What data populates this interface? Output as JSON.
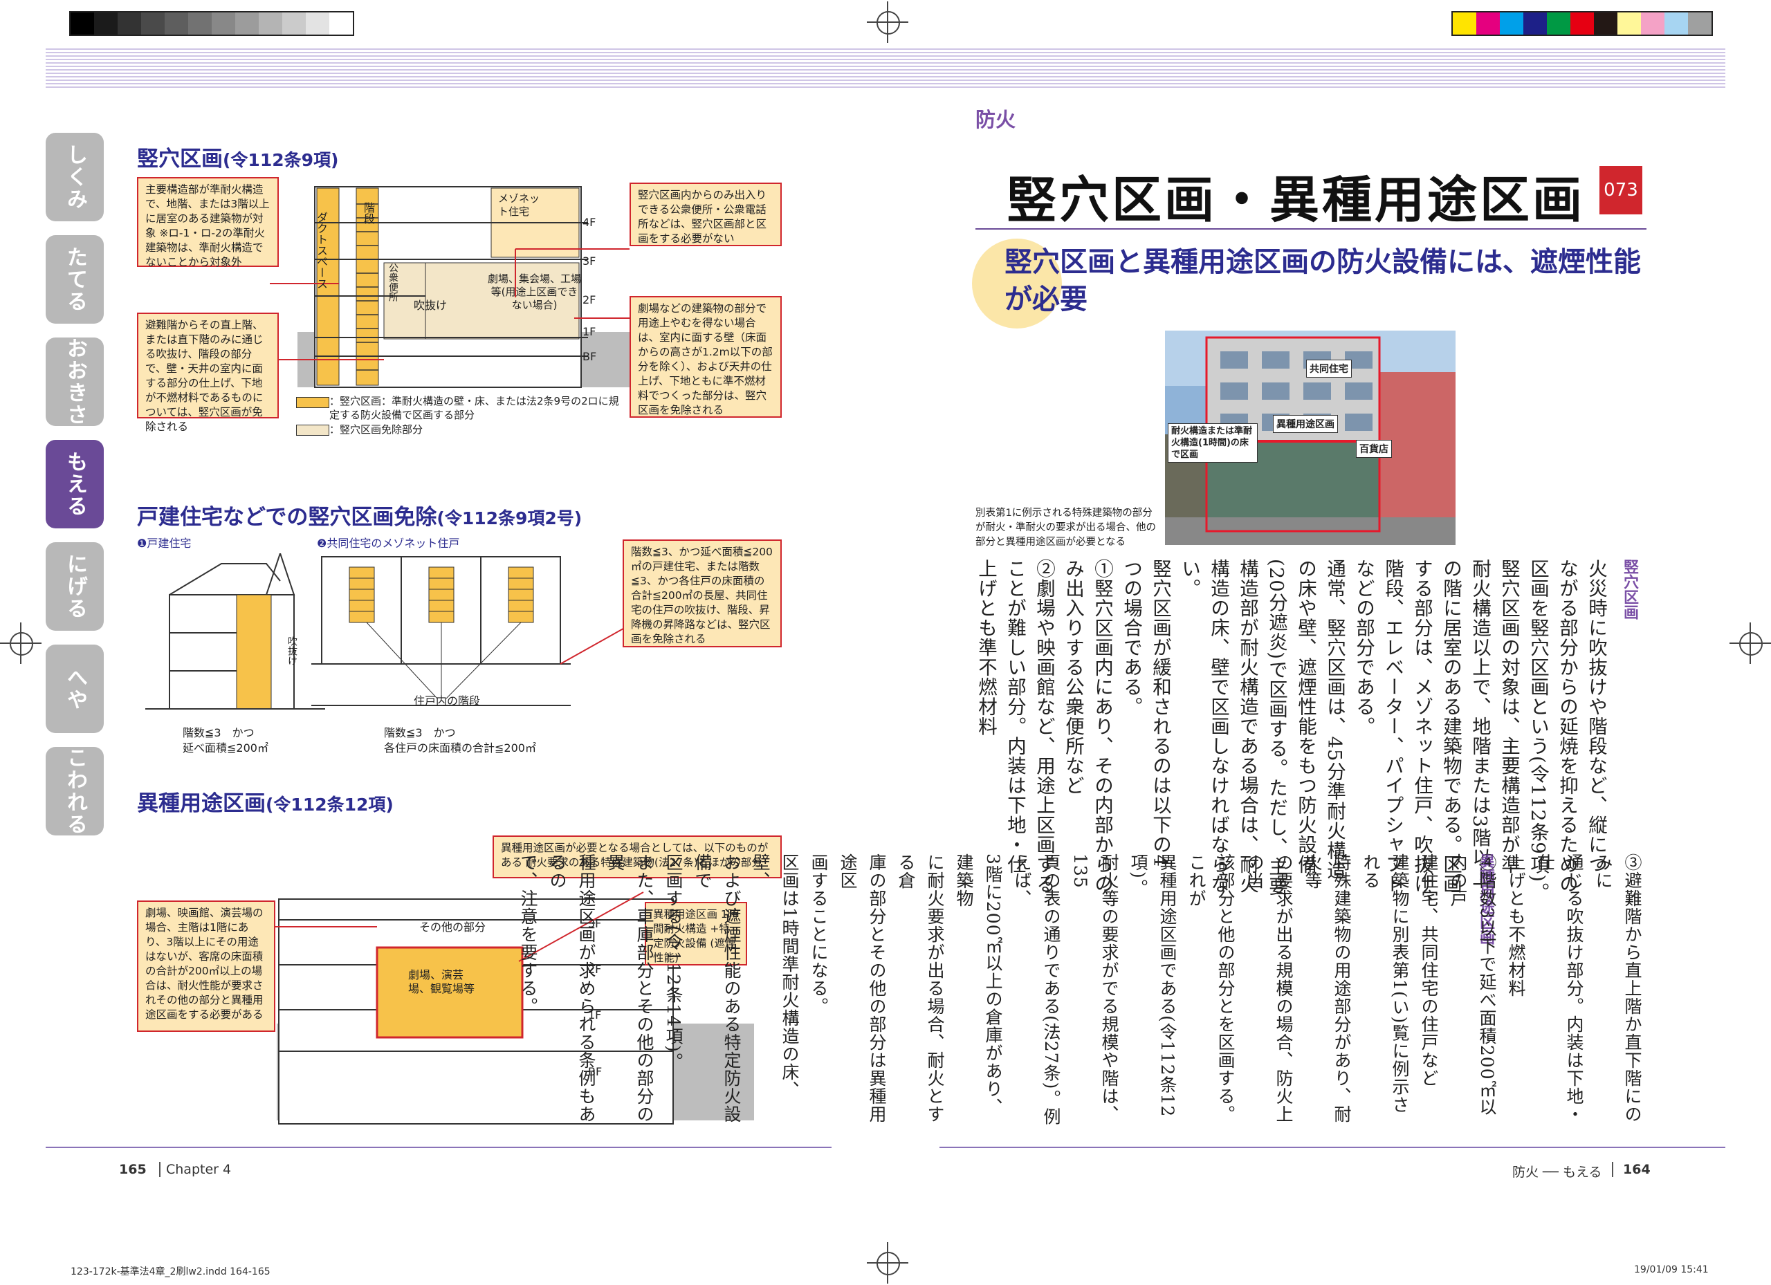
{
  "colors": {
    "accent_purple": "#6a4a97",
    "title_navy": "#2c2c8f",
    "callout_fill": "#fde7b6",
    "callout_border": "#d0262d",
    "shaft_fill": "#f7c24a",
    "chapter_number_red": "#d0262d"
  },
  "side_tabs": [
    {
      "label": "しくみ",
      "active": false
    },
    {
      "label": "たてる",
      "active": false
    },
    {
      "label": "おおきさ",
      "active": false
    },
    {
      "label": "もえる",
      "active": true
    },
    {
      "label": "にげる",
      "active": false
    },
    {
      "label": "へや",
      "active": false
    },
    {
      "label": "こわれる",
      "active": false
    }
  ],
  "left_page": {
    "section1": {
      "title": "竪穴区画",
      "ref": "(令112条9項)",
      "callout_tl": "主要構造部が準耐火構造で、地階、または3階以上に居室のある建築物が対象 ※ロ-1・ロ-2の準耐火建築物は、準耐火構造でないことから対象外",
      "callout_bl": "避難階からその直上階、または直下階のみに通じる吹抜け、階段の部分で、壁・天井の室内に面する部分の仕上げ、下地が不燃材料であるものについては、竪穴区画が免除される",
      "callout_tr": "竪穴区画内からのみ出入りできる公衆便所・公衆電話所などは、竪穴区画部と区画をする必要がない",
      "callout_br": "劇場などの建築物の部分で用途上やむを得ない場合は、室内に面する壁（床面からの高さが1.2m以下の部分を除く）、および天井の仕上げ、下地ともに準不燃材料でつくった部分は、竪穴区画を免除される",
      "labels": {
        "duct": "ダクトスペース",
        "stairs": "階段",
        "maisonette": "メゾネット住宅",
        "toilet": "公衆便所",
        "atrium": "吹抜け",
        "theater": "劇場、集会場、工場等(用途上区画できない場合)",
        "f4": "4F",
        "f3": "3F",
        "f2": "2F",
        "f1": "1F",
        "bf": "BF"
      },
      "legend1": "：竪穴区画：準耐火構造の壁・床、または法2条9号の2ロに規定する防火設備で区画する部分",
      "legend2": "：竪穴区画免除部分"
    },
    "section2": {
      "title": "戸建住宅などでの竪穴区画免除",
      "ref": "(令112条9項2号)",
      "sub1": "❶戸建住宅",
      "sub2": "❷共同住宅のメゾネット住戸",
      "atrium": "吹抜け",
      "inner_stairs": "住戸内の階段",
      "cap1a": "階数≦3　かつ",
      "cap1b": "延べ面積≦200㎡",
      "cap2a": "階数≦3　かつ",
      "cap2b": "各住戸の床面積の合計≦200㎡",
      "callout": "階数≦3、かつ延べ面積≦200㎡の戸建住宅、または階数≦3、かつ各住戸の床面積の合計≦200㎡の長屋、共同住宅の住戸の吹抜け、階段、昇降機の昇降路などは、竪穴区画を免除される"
    },
    "section3": {
      "title": "異種用途区画",
      "ref": "(令112条12項)",
      "callout_top": "異種用途区画が必要となる場合としては、以下のものがある 耐火要求のある特殊建築物(法27条)とほかの部分",
      "callout_left": "劇場、映画館、演芸場の場合、主階は1階にあり、3階以上にその用途はないが、客席の床面積の合計が200㎡以上の場合は、耐火性能が要求されその他の部分と異種用途区画をする必要がある",
      "callout_right": "異種用途区画 1時間耐火構造 +特定防火設備 (遮煙性能)",
      "other_part": "その他の部分",
      "theater": "劇場、演芸場、観覧場等",
      "f3": "3F",
      "f2": "2F",
      "f1": "1F",
      "bf": "BF"
    },
    "footer_page": "165",
    "footer_chapter": "Chapter 4"
  },
  "right_page": {
    "category": "防火",
    "title": "竪穴区画・異種用途区画",
    "number": "073",
    "lead": "竪穴区画と異種用途区画の防火設備には、遮煙性能が必要",
    "photo_labels": {
      "apartment": "共同住宅",
      "zone": "異種用途区画",
      "dept": "百貨店",
      "floor": "耐火構造または準耐火構造(1時間)の床で区画"
    },
    "photo_caption": "別表第1に例示される特殊建築物の部分が耐火・準耐火の要求が出る場合、他の部分と異種用途区画が必要となる",
    "heading1": "竪穴区画",
    "heading2": "異種用途区画",
    "columns_a": [
      "火災時に吹抜けや階段など、縦につ",
      "ながる部分からの延焼を抑えるための",
      "区画を竪穴区画という(令112条9項)。",
      "竪穴区画の対象は、主要構造部が準",
      "耐火構造以上で、地階または3階以上",
      "の階に居室のある建築物である。区画",
      "する部分は、メゾネット住戸、吹抜け、",
      "階段、エレベーター、パイプシャフト",
      "などの部分である。",
      "通常、竪穴区画は、45分準耐火構造",
      "の床や壁、遮煙性能をもつ防火設備",
      "(20分遮炎)で区画する。ただし、主要",
      "構造部が耐火構造である場合は、耐火",
      "構造の床、壁で区画しなければならな",
      "い。",
      "竪穴区画が緩和されるのは以下の4",
      "つの場合である。",
      "①竪穴区画内にあり、その内部からの",
      "み出入りする公衆便所など",
      "②劇場や映画館など、用途上区画する",
      "ことが難しい部分。内装は下地・仕",
      "上げとも準不燃材料"
    ],
    "columns_b": [
      "③避難階から直上階か直下階にのみに",
      "通じる吹抜け部分。内装は下地・仕",
      "上げとも不燃材料",
      "④階数3以下で延べ面積200㎡以内の戸",
      "建住宅、共同住宅の住戸など",
      "",
      "建築物に別表第1(い)覧に例示される",
      "特殊建築物の用途部分があり、耐火等",
      "の要求が出る規模の場合、防火上の当",
      "該部分と他の部分とを区画する。これが",
      "異種用途区画である(令112条12項)。",
      "耐火等の要求がでる規模や階は、135",
      "頁の表の通りである(法27条)。例えば、",
      "3階に200㎡以上の倉庫があり、建築物",
      "に耐火要求が出る場合、耐火とする倉",
      "庫の部分とその他の部分は異種用途区",
      "画することになる。",
      "区画は1時間準耐火構造の床、壁、",
      "および遮煙性能のある特定防火設備で",
      "区画する(令112条14項)。",
      "また、車庫部分とその他の部分の異",
      "種用途区画が求められる条例もあるの",
      "で、注意を要する。"
    ],
    "footer_section": "防火 ── もえる",
    "footer_page": "164"
  },
  "imprint": {
    "file": "123-172k-基準法4章_2刷lw2.indd 164-165",
    "date": "19/01/09 15:41"
  }
}
